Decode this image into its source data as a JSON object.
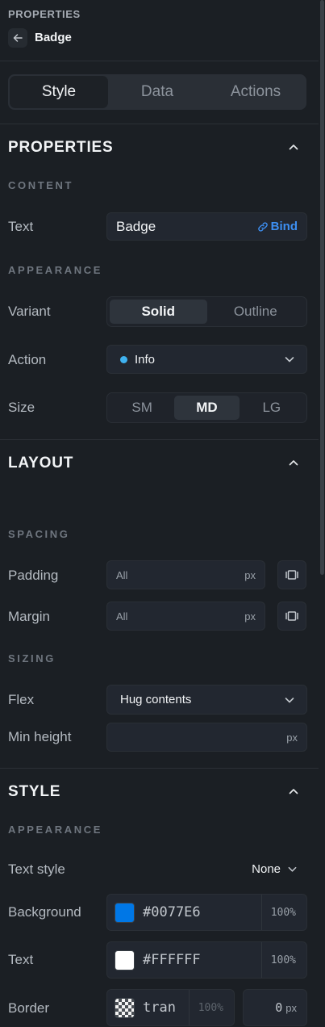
{
  "header": {
    "caption": "PROPERTIES",
    "title": "Badge"
  },
  "tabs": [
    {
      "label": "Style",
      "active": true
    },
    {
      "label": "Data",
      "active": false
    },
    {
      "label": "Actions",
      "active": false
    }
  ],
  "properties": {
    "title": "PROPERTIES",
    "content_caption": "CONTENT",
    "text": {
      "label": "Text",
      "value": "Badge",
      "bind_label": "Bind"
    },
    "appearance_caption": "APPEARANCE",
    "variant": {
      "label": "Variant",
      "options": [
        "Solid",
        "Outline"
      ],
      "selected": "Solid"
    },
    "action": {
      "label": "Action",
      "value": "Info",
      "dot_color": "#3FB2F0"
    },
    "size": {
      "label": "Size",
      "options": [
        "SM",
        "MD",
        "LG"
      ],
      "selected": "MD"
    }
  },
  "layout": {
    "title": "LAYOUT",
    "spacing_caption": "SPACING",
    "padding": {
      "label": "Padding",
      "value": "All",
      "unit": "px"
    },
    "margin": {
      "label": "Margin",
      "value": "All",
      "unit": "px"
    },
    "sizing_caption": "SIZING",
    "flex": {
      "label": "Flex",
      "value": "Hug contents"
    },
    "min_height": {
      "label": "Min height",
      "value": "",
      "unit": "px"
    }
  },
  "style": {
    "title": "STYLE",
    "appearance_caption": "APPEARANCE",
    "text_style": {
      "label": "Text style",
      "value": "None"
    },
    "background": {
      "label": "Background",
      "hex": "#0077E6",
      "opacity": "100%",
      "color": "#0077E6"
    },
    "text_color": {
      "label": "Text",
      "hex": "#FFFFFF",
      "opacity": "100%",
      "color": "#FFFFFF"
    },
    "border": {
      "label": "Border",
      "hex": "tran",
      "opacity": "100%",
      "width": "0",
      "unit": "px"
    }
  }
}
